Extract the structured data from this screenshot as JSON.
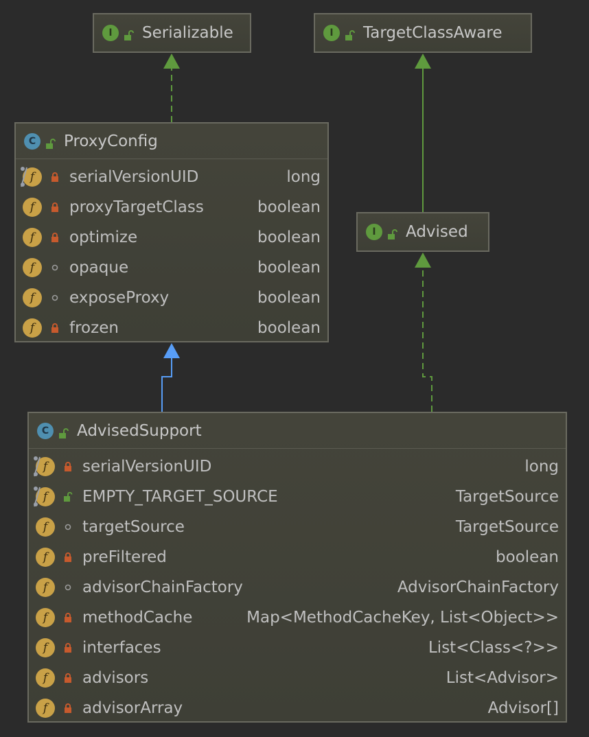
{
  "interfaces": [
    {
      "id": "serializable",
      "kind": "I",
      "name": "Serializable"
    },
    {
      "id": "targetclassaware",
      "kind": "I",
      "name": "TargetClassAware"
    },
    {
      "id": "advised",
      "kind": "I",
      "name": "Advised"
    }
  ],
  "classes": [
    {
      "id": "proxyconfig",
      "kind": "C",
      "name": "ProxyConfig",
      "fields": [
        {
          "name": "serialVersionUID",
          "type": "long",
          "modifier": "private",
          "static": true
        },
        {
          "name": "proxyTargetClass",
          "type": "boolean",
          "modifier": "private",
          "static": false
        },
        {
          "name": "optimize",
          "type": "boolean",
          "modifier": "private",
          "static": false
        },
        {
          "name": "opaque",
          "type": "boolean",
          "modifier": "package",
          "static": false
        },
        {
          "name": "exposeProxy",
          "type": "boolean",
          "modifier": "package",
          "static": false
        },
        {
          "name": "frozen",
          "type": "boolean",
          "modifier": "private",
          "static": false
        }
      ]
    },
    {
      "id": "advisedsupport",
      "kind": "C",
      "name": "AdvisedSupport",
      "fields": [
        {
          "name": "serialVersionUID",
          "type": "long",
          "modifier": "private",
          "static": true
        },
        {
          "name": "EMPTY_TARGET_SOURCE",
          "type": "TargetSource",
          "modifier": "public",
          "static": true
        },
        {
          "name": "targetSource",
          "type": "TargetSource",
          "modifier": "package",
          "static": false
        },
        {
          "name": "preFiltered",
          "type": "boolean",
          "modifier": "private",
          "static": false
        },
        {
          "name": "advisorChainFactory",
          "type": "AdvisorChainFactory",
          "modifier": "package",
          "static": false
        },
        {
          "name": "methodCache",
          "type": "Map<MethodCacheKey, List<Object>>",
          "modifier": "private",
          "static": false
        },
        {
          "name": "interfaces",
          "type": "List<Class<?>>",
          "modifier": "private",
          "static": false
        },
        {
          "name": "advisors",
          "type": "List<Advisor>",
          "modifier": "private",
          "static": false
        },
        {
          "name": "advisorArray",
          "type": "Advisor[]",
          "modifier": "private",
          "static": false
        }
      ]
    }
  ],
  "edges": [
    {
      "from": "proxyconfig",
      "to": "serializable",
      "kind": "implements"
    },
    {
      "from": "advised",
      "to": "targetclassaware",
      "kind": "extends"
    },
    {
      "from": "advisedsupport",
      "to": "proxyconfig",
      "kind": "extends"
    },
    {
      "from": "advisedsupport",
      "to": "advised",
      "kind": "implements"
    }
  ],
  "colors": {
    "background": "#2b2b2b",
    "implements_edge": "#5f9a3e",
    "extends_interface_edge": "#5f9a3e",
    "extends_class_edge": "#589df6",
    "field_badge": "#c9a147",
    "interface_badge": "#5f9a3e",
    "class_badge": "#4f8fb0",
    "private_modifier": "#c75a2d",
    "public_modifier": "#5f9a3e",
    "package_modifier": "#9a9a9a"
  }
}
